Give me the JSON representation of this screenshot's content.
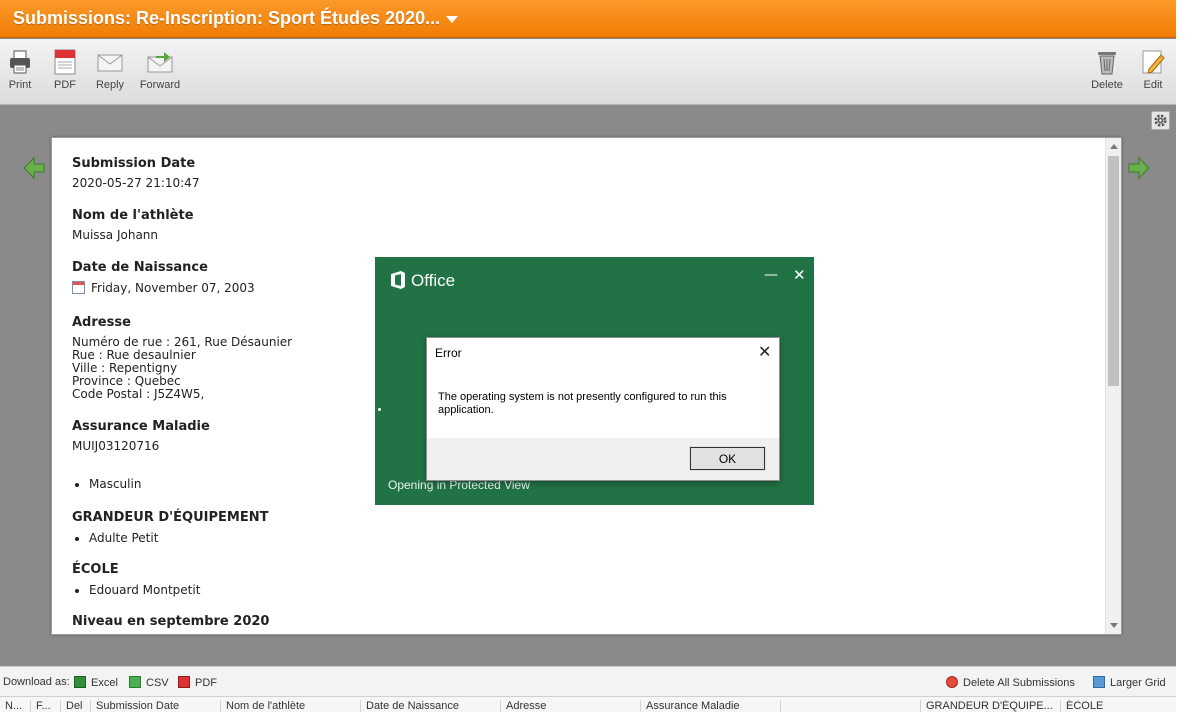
{
  "title": "Submissions: Re-Inscription: Sport Études 2020...",
  "toolbar": {
    "print": "Print",
    "pdf": "PDF",
    "reply": "Reply",
    "forward": "Forward",
    "delete": "Delete",
    "edit": "Edit"
  },
  "submission": {
    "submission_date_label": "Submission Date",
    "submission_date": "2020-05-27 21:10:47",
    "nom_label": "Nom de l'athlète",
    "nom": "Muissa Johann",
    "naissance_label": "Date de Naissance",
    "naissance": "Friday, November 07, 2003",
    "adresse_label": "Adresse",
    "adresse_lines": [
      "Numéro de rue : 261, Rue Désaunier",
      "Rue : Rue desaulnier",
      "Ville : Repentigny",
      "Province : Quebec",
      "Code Postal : J5Z4W5,"
    ],
    "assurance_label": "Assurance Maladie",
    "assurance": "MUIJ03120716",
    "sexe": "Masculin",
    "grandeur_label": "GRANDEUR D'ÉQUIPEMENT",
    "grandeur": "Adulte Petit",
    "ecole_label": "ÉCOLE",
    "ecole": "Edouard Montpetit",
    "niveau_label": "Niveau en septembre 2020"
  },
  "office": {
    "brand": "Office",
    "status": "Opening in Protected View"
  },
  "dialog": {
    "title": "Error",
    "message": "The operating system is not presently configured to run this application.",
    "ok": "OK"
  },
  "download": {
    "label": "Download as:",
    "excel": "Excel",
    "csv": "CSV",
    "pdf": "PDF",
    "delete_all": "Delete All Submissions",
    "larger_grid": "Larger Grid"
  },
  "grid_columns": [
    "N...",
    "F...",
    "Del",
    "Submission Date",
    "Nom de l'athlète",
    "Date de Naissance",
    "Adresse",
    "Assurance Maladie",
    "",
    "GRANDEUR D'ÉQUIPE...",
    "ÉCOLE"
  ],
  "colors": {
    "title_orange": "#f07c05",
    "office_green": "#217346",
    "arrow_green": "#5aa83a"
  }
}
